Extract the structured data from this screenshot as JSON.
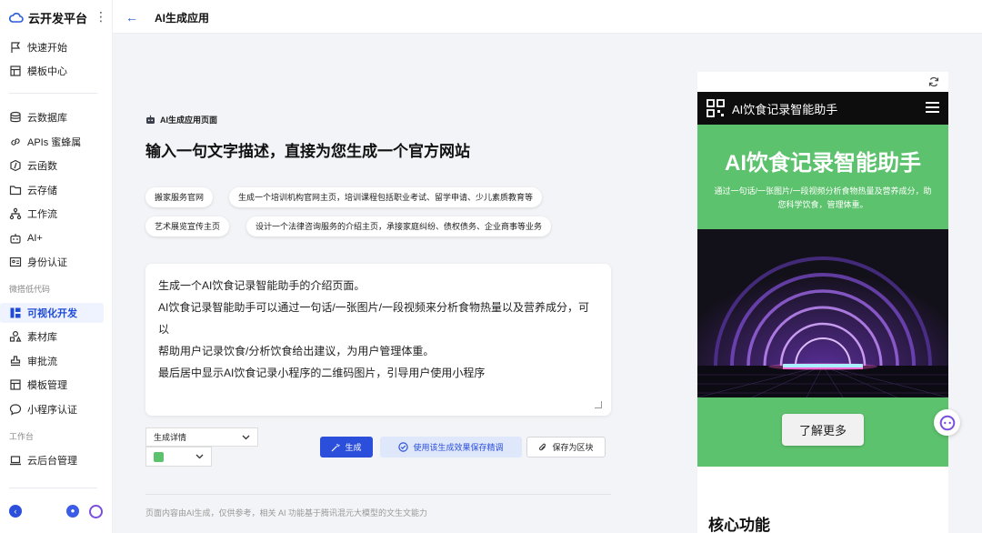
{
  "sidebar": {
    "brand": "云开发平台",
    "more_glyph": "⋮",
    "items": [
      {
        "label": "快速开始"
      },
      {
        "label": "模板中心"
      },
      {
        "label": "云数据库"
      },
      {
        "label": "APIs 蜜蜂属"
      },
      {
        "label": "云函数"
      },
      {
        "label": "云存储"
      },
      {
        "label": "工作流"
      },
      {
        "label": "AI+"
      },
      {
        "label": "身份认证"
      },
      {
        "label": "可视化开发"
      },
      {
        "label": "素材库"
      },
      {
        "label": "审批流"
      },
      {
        "label": "模板管理"
      },
      {
        "label": "小程序认证"
      },
      {
        "label": "云后台管理"
      }
    ],
    "sections": [
      "微搭低代码",
      "工作台"
    ],
    "collapse_glyph": "‹",
    "user_glyph": "●"
  },
  "header": {
    "back_glyph": "←",
    "title": "AI生成应用"
  },
  "main": {
    "tag": "AI生成应用页面",
    "heading": "输入一句文字描述，直接为您生成一个官方网站",
    "chips": [
      "搬家服务官网",
      "生成一个培训机构官网主页，培训课程包括职业考试、留学申请、少儿素质教育等",
      "艺术展览宣传主页",
      "设计一个法律咨询服务的介绍主页，承接家庭纠纷、债权债务、企业商事等业务"
    ],
    "prompt_lines": [
      "生成一个AI饮食记录智能助手的介绍页面。",
      "AI饮食记录智能助手可以通过一句话/一张图片/一段视频来分析食物热量以及营养成分，可以",
      "帮助用户记录饮食/分析饮食给出建议，为用户管理体重。",
      "最后居中显示AI饮食记录小程序的二维码图片，引导用户使用小程序"
    ],
    "detail_select": "生成详情",
    "color_value": "#5dc26d",
    "buttons": {
      "generate": "生成",
      "use_effect": "使用该生成效果保存精调",
      "save_block": "保存为区块"
    },
    "footer_note": "页面内容由AI生成，仅供参考，相关 AI 功能基于腾讯混元大模型的文生文能力"
  },
  "preview": {
    "nav_title": "AI饮食记录智能助手",
    "hero_title": "AI饮食记录智能助手",
    "hero_subtitle": "通过一句话/一张图片/一段视频分析食物热量及营养成分，助您科学饮食，管理体重。",
    "cta": "了解更多",
    "section_title": "核心功能"
  },
  "colors": {
    "accent": "#2b4fdb",
    "hero_green": "#5dc26d"
  }
}
